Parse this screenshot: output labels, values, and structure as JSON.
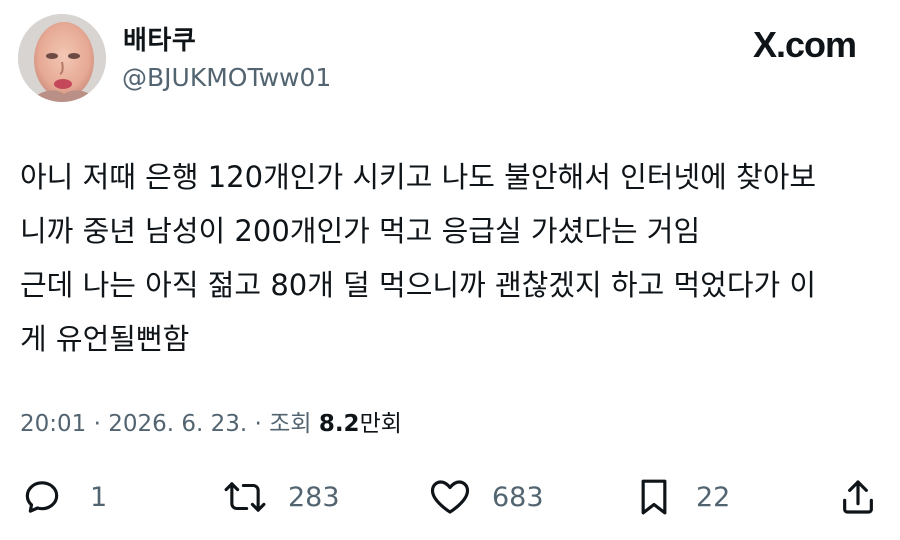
{
  "author": {
    "display_name": "배타쿠",
    "handle": "@BJUKMOTww01"
  },
  "brand": "X.com",
  "tweet": {
    "lines": [
      "아니 저때 은행 120개인가 시키고 나도 불안해서 인터넷에 찾아보",
      "니까 중년 남성이 200개인가 먹고 응급실 가셨다는 거임",
      "근데 나는 아직 젊고 80개 덜 먹으니까 괜찮겠지 하고 먹었다가 이",
      "게 유언될뻔함"
    ]
  },
  "meta": {
    "time": "20:01",
    "separator": "·",
    "date": "2026. 6. 23.",
    "views_label": "조회",
    "views_count": "8.2",
    "views_unit": "만회"
  },
  "actions": {
    "reply": {
      "icon": "reply-icon",
      "count": "1"
    },
    "retweet": {
      "icon": "retweet-icon",
      "count": "283"
    },
    "like": {
      "icon": "heart-icon",
      "count": "683"
    },
    "bookmark": {
      "icon": "bookmark-icon",
      "count": "22"
    },
    "share": {
      "icon": "share-icon"
    }
  },
  "colors": {
    "text": "#0f1419",
    "secondary": "#536471",
    "background": "#ffffff"
  }
}
